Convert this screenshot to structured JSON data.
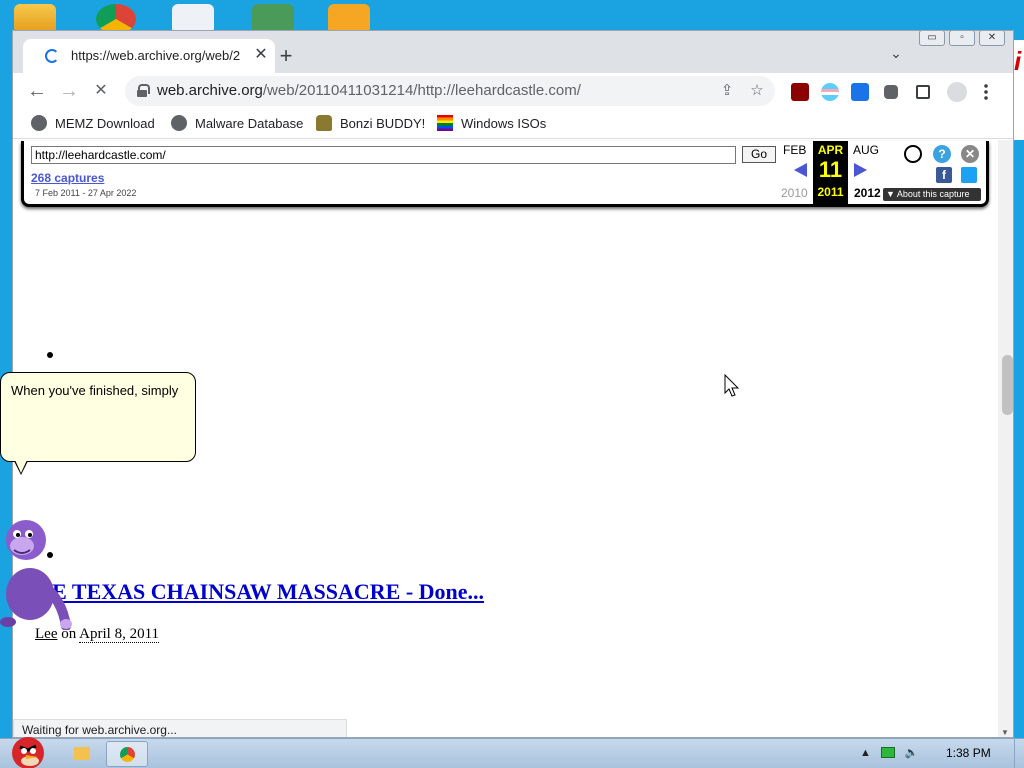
{
  "colors": {
    "desktop": "#1aa3e0",
    "link": "#0000cc",
    "wayback_accent": "#4a56d3",
    "balloon_bg": "#ffffe1"
  },
  "window": {
    "controls": {
      "minimize": "▭",
      "restore": "▫",
      "close": "✕"
    }
  },
  "browser": {
    "tab": {
      "title": "https://web.archive.org/web/2",
      "close": "✕"
    },
    "new_tab_label": "+",
    "tab_search": "⌄",
    "nav": {
      "back": "←",
      "forward": "→",
      "stop": "✕"
    },
    "address": {
      "host": "web.archive.org",
      "path": "/web/20110411031214/http://leehardcastle.com/"
    },
    "omni_icons": {
      "share": "⇪",
      "star": "☆"
    },
    "bookmarks": [
      {
        "label": "MEMZ Download",
        "icon": "globe-icon"
      },
      {
        "label": "Malware Database",
        "icon": "globe-icon"
      },
      {
        "label": "Bonzi BUDDY!",
        "icon": "bonzi-icon"
      },
      {
        "label": "Windows ISOs",
        "icon": "rainbow-flag-icon"
      }
    ],
    "status": "Waiting for web.archive.org..."
  },
  "wayback": {
    "url_value": "http://leehardcastle.com/",
    "go": "Go",
    "captures": "268 captures",
    "range": "7 Feb 2011 - 27 Apr 2022",
    "prev_month": "FEB",
    "cur_month": "APR",
    "next_month": "AUG",
    "cur_day": "11",
    "prev_year": "2010",
    "cur_year": "2011",
    "next_year": "2012",
    "about": "▼ About this capture"
  },
  "page": {
    "post_title": "HE TEXAS CHAINSAW MASSACRE - Done...",
    "byline_author": "Lee",
    "byline_on": "on",
    "byline_date": "April 8, 2011"
  },
  "bonzi": {
    "balloon": "When you've finished, simply"
  },
  "taskbar": {
    "clock": "1:38 PM"
  }
}
